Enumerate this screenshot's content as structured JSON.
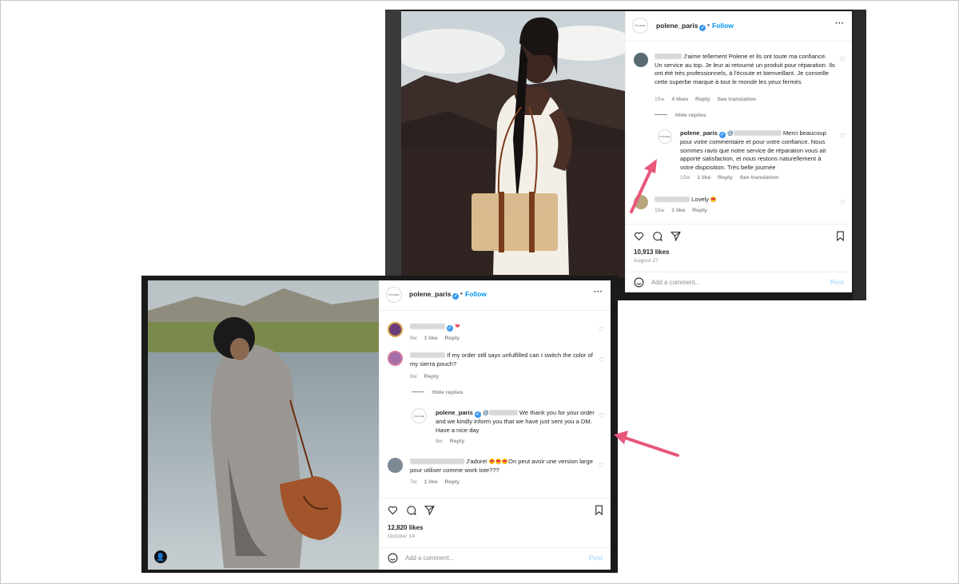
{
  "top_post": {
    "account": "polene_paris",
    "follow_label": "Follow",
    "logo_text": "POLENE",
    "comments": [
      {
        "text": "J'aime tellement Polene et ils ont toute ma confiance. Un service au top. Je leur ai retourné un produit pour réparation. Ils ont été très professionnels, à l'écoute et bienveillant. Je conseille cette superbe marque à tout le monde les yeux fermés",
        "age": "15w",
        "likes": "4 likes",
        "reply": "Reply",
        "translate": "See translation"
      }
    ],
    "hide_replies": "Hide replies",
    "reply": {
      "user": "polene_paris",
      "mention": "@",
      "text": "Merci beaucoup pour votre commentaire et pour votre confiance. Nous sommes ravis que notre service de réparation vous ait apporté satisfaction, et nous restons naturellement à votre disposition. Très belle journée",
      "age": "15w",
      "likes": "1 like",
      "reply_label": "Reply",
      "translate": "See translation"
    },
    "comment_lovely": {
      "text": "Lovely",
      "age": "15w",
      "likes": "1 like",
      "reply": "Reply"
    },
    "likes": "10,913 likes",
    "date": "August 27",
    "add_comment_placeholder": "Add a comment...",
    "post_label": "Post"
  },
  "bottom_post": {
    "account": "polene_paris",
    "follow_label": "Follow",
    "logo_text": "POLENE",
    "comment_heart": {
      "age": "8w",
      "likes": "1 like",
      "reply": "Reply"
    },
    "comment_order": {
      "text": "If my order still says unfulfilled can I switch the color of my sierra pouch?",
      "age": "8w",
      "reply": "Reply"
    },
    "hide_replies": "Hide replies",
    "reply": {
      "user": "polene_paris",
      "mention": "@",
      "text": "We thank you for your order and we kindly inform you that we have just sent you a DM. Have a nice day",
      "age": "8w",
      "reply_label": "Reply"
    },
    "comment_adore": {
      "text_before": "J'adore!",
      "text_after": "On peut avoir une version large pour utiliser comme work tote???",
      "age": "7w",
      "likes": "1 like",
      "reply": "Reply"
    },
    "likes": "12,820 likes",
    "date": "October 14",
    "add_comment_placeholder": "Add a comment...",
    "post_label": "Post"
  },
  "colors": {
    "annotation_arrow": "#e8567a",
    "link_blue": "#0095f6",
    "verified_blue": "#3897f0"
  }
}
